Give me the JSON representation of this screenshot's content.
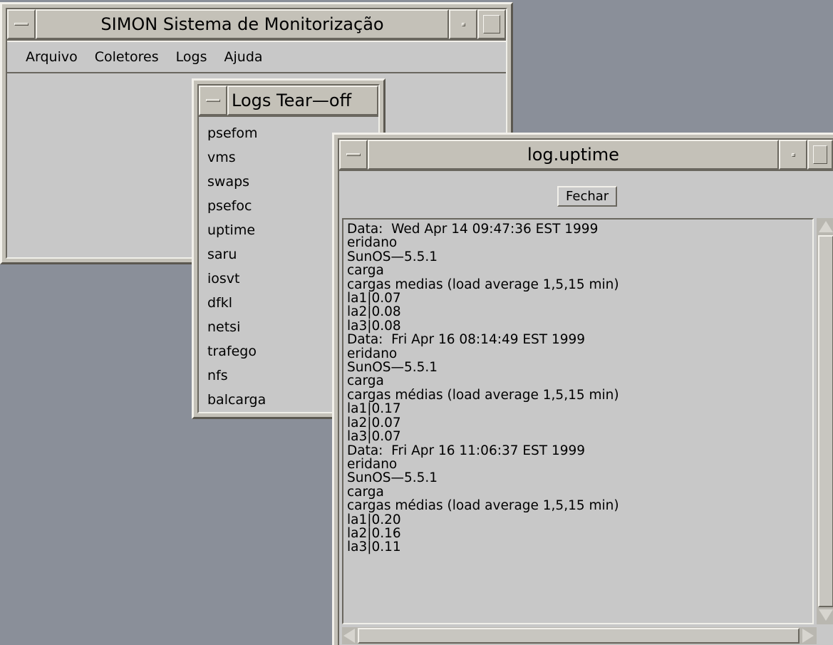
{
  "main_window": {
    "title": "SIMON Sistema de Monitorização",
    "menu": [
      "Arquivo",
      "Coletores",
      "Logs",
      "Ajuda"
    ]
  },
  "tearoff_window": {
    "title": "Logs Tear—off",
    "items": [
      "psefom",
      "vms",
      "swaps",
      "psefoc",
      "uptime",
      "saru",
      "iosvt",
      "dfkl",
      "netsi",
      "trafego",
      "nfs",
      "balcarga"
    ]
  },
  "log_window": {
    "title": "log.uptime",
    "close_button": "Fechar",
    "lines": [
      "Data:  Wed Apr 14 09:47:36 EST 1999",
      "eridano",
      "SunOS—5.5.1",
      "carga",
      "cargas medias (load average 1,5,15 min)",
      "la1|0.07",
      "la2|0.08",
      "la3|0.08",
      "Data:  Fri Apr 16 08:14:49 EST 1999",
      "eridano",
      "SunOS—5.5.1",
      "carga",
      "cargas médias (load average 1,5,15 min)",
      "la1|0.17",
      "la2|0.07",
      "la3|0.07",
      "Data:  Fri Apr 16 11:06:37 EST 1999",
      "eridano",
      "SunOS—5.5.1",
      "carga",
      "cargas médias (load average 1,5,15 min)",
      "la1|0.20",
      "la2|0.16",
      "la3|0.11"
    ]
  },
  "icons": {
    "window_menu": "window-menu-icon",
    "minimize": "minimize-icon",
    "maximize": "maximize-icon"
  }
}
